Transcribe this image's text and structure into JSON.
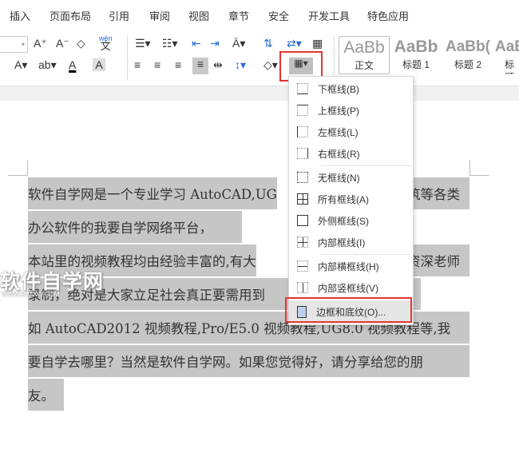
{
  "tabs": [
    "插入",
    "页面布局",
    "引用",
    "审阅",
    "视图",
    "章节",
    "安全",
    "开发工具",
    "特色应用"
  ],
  "toolbar": {
    "pinyin_label": "wén",
    "styles": [
      {
        "sample": "AaBb",
        "name": "正文"
      },
      {
        "sample": "AaBb",
        "name": "标题 1"
      },
      {
        "sample": "AaBb(",
        "name": "标题 2"
      },
      {
        "sample": "AaB",
        "name": "标题"
      }
    ]
  },
  "document": {
    "lines": [
      {
        "left": "软件自学网是一个专业学习 AutoCAD,UG",
        "right": "筑等各类"
      },
      {
        "left": "办公软件的我要自学网络平台，",
        "right": ""
      },
      {
        "left": "本站里的视频教程均由经验丰富的,有大",
        "right": "资深老师"
      },
      {
        "left": "录制，绝对是大家立足社会真正要需用到",
        "right": ""
      },
      {
        "left": "如 AutoCAD2012 视频教程,Pro/E5.0 视频教程,UG8.0 视频教程等,我",
        "right": ""
      },
      {
        "left": "要自学去哪里？当然是软件自学网。如果您觉得好，请分享给您的朋",
        "right": ""
      },
      {
        "left": "友。",
        "right": ""
      }
    ]
  },
  "watermark": {
    "title": "软件自学网",
    "url": "WWW.RJZXW.COM"
  },
  "border_menu": {
    "items": [
      "下框线(B)",
      "上框线(P)",
      "左框线(L)",
      "右框线(R)",
      "无框线(N)",
      "所有框线(A)",
      "外侧框线(S)",
      "内部框线(I)",
      "内部横框线(H)",
      "内部竖框线(V)",
      "边框和底纹(O)..."
    ]
  },
  "colors": {
    "highlight_red": "#e8332e",
    "selection": "#c6c6c6"
  }
}
